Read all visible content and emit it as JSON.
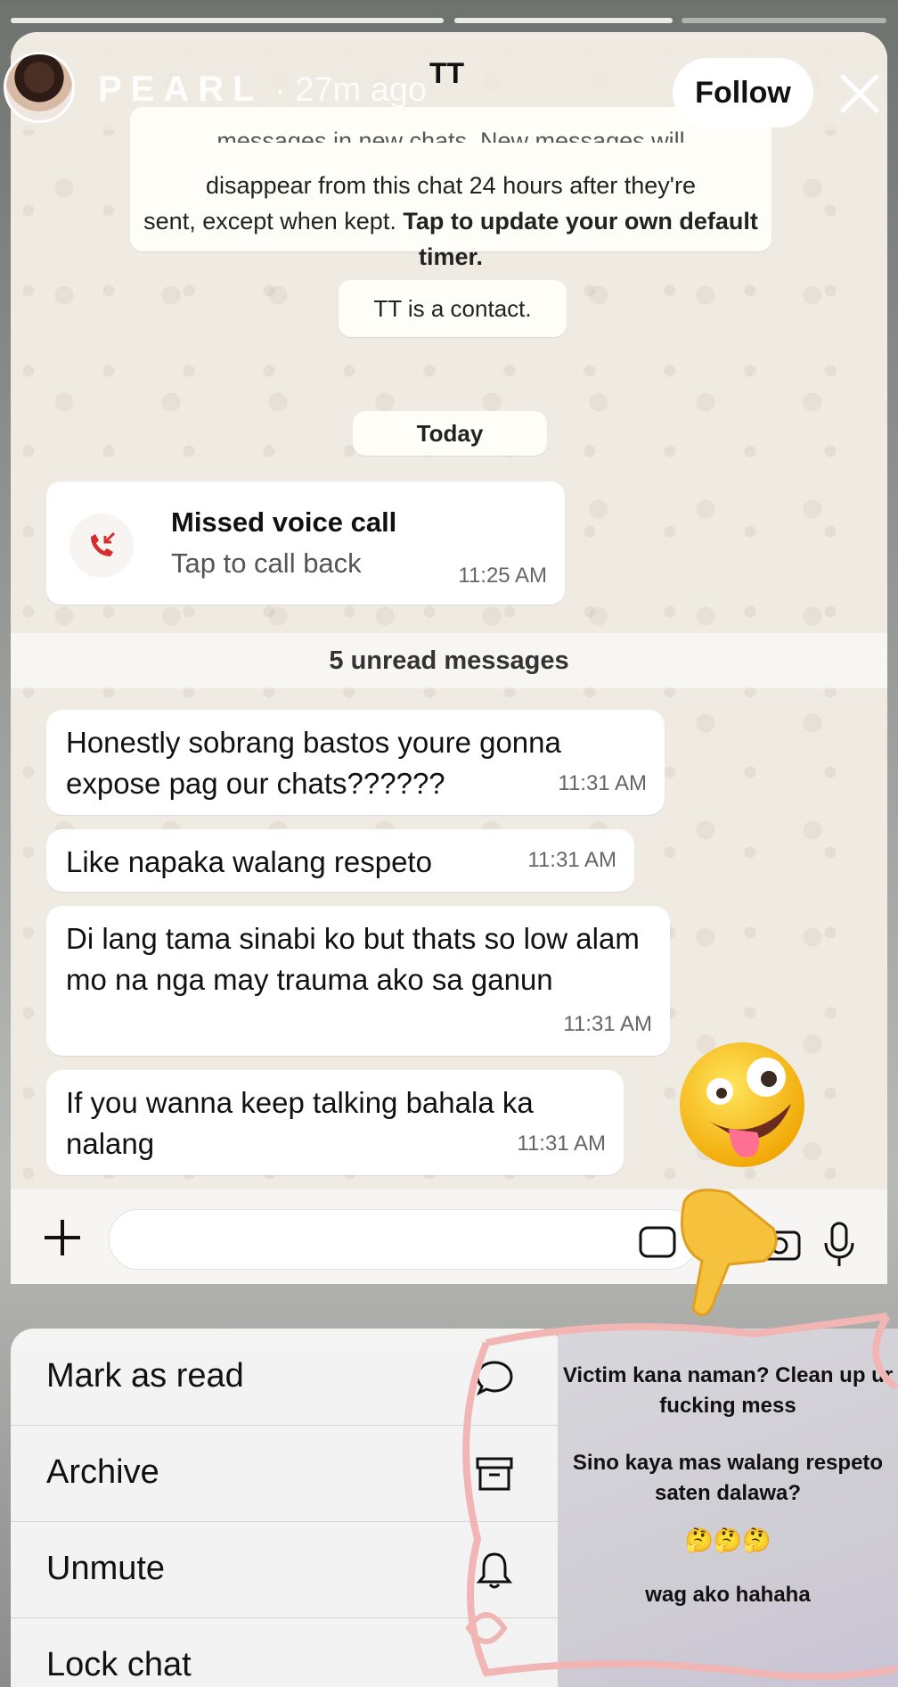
{
  "story": {
    "username": "PEARL",
    "time_ago": "· 27m ago",
    "follow_label": "Follow"
  },
  "chat": {
    "title": "TT",
    "disappearing_notice_cut": "messages in new chats. New messages will",
    "disappearing_notice_line1": "disappear from this chat 24 hours after they're",
    "disappearing_notice_line2": "sent, except when kept.",
    "disappearing_notice_link": "Tap to update your own default timer.",
    "contact_notice": "TT is a contact.",
    "date_divider": "Today",
    "missed_call": {
      "title": "Missed voice call",
      "subtitle": "Tap to call back",
      "time": "11:25 AM"
    },
    "unread_divider": "5 unread messages",
    "messages": [
      {
        "text": "Honestly sobrang bastos youre gonna expose pag our chats??????",
        "time": "11:31 AM"
      },
      {
        "text": "Like napaka walang respeto",
        "time": "11:31 AM"
      },
      {
        "text": "Di lang tama sinabi ko but thats so low alam mo na nga may trauma ako sa ganun",
        "time": "11:31 AM"
      },
      {
        "text": "If you wanna keep talking bahala ka nalang",
        "time": "11:31 AM"
      }
    ]
  },
  "menu": {
    "items": [
      {
        "label": "Mark as read",
        "icon": "chat-bubble-icon"
      },
      {
        "label": "Archive",
        "icon": "archive-icon"
      },
      {
        "label": "Unmute",
        "icon": "bell-icon"
      },
      {
        "label": "Lock chat",
        "icon": "lock-icon"
      }
    ]
  },
  "note": {
    "line1": "Victim kana naman? Clean up ur fucking mess",
    "line2": "Sino kaya mas walang respeto saten dalawa?",
    "emojis": "🤔🤔🤔",
    "line3": "wag ako hahaha"
  },
  "colors": {
    "chat_bg": "#efeae2",
    "bubble": "#ffffff",
    "missed_call_red": "#d32f2f"
  }
}
